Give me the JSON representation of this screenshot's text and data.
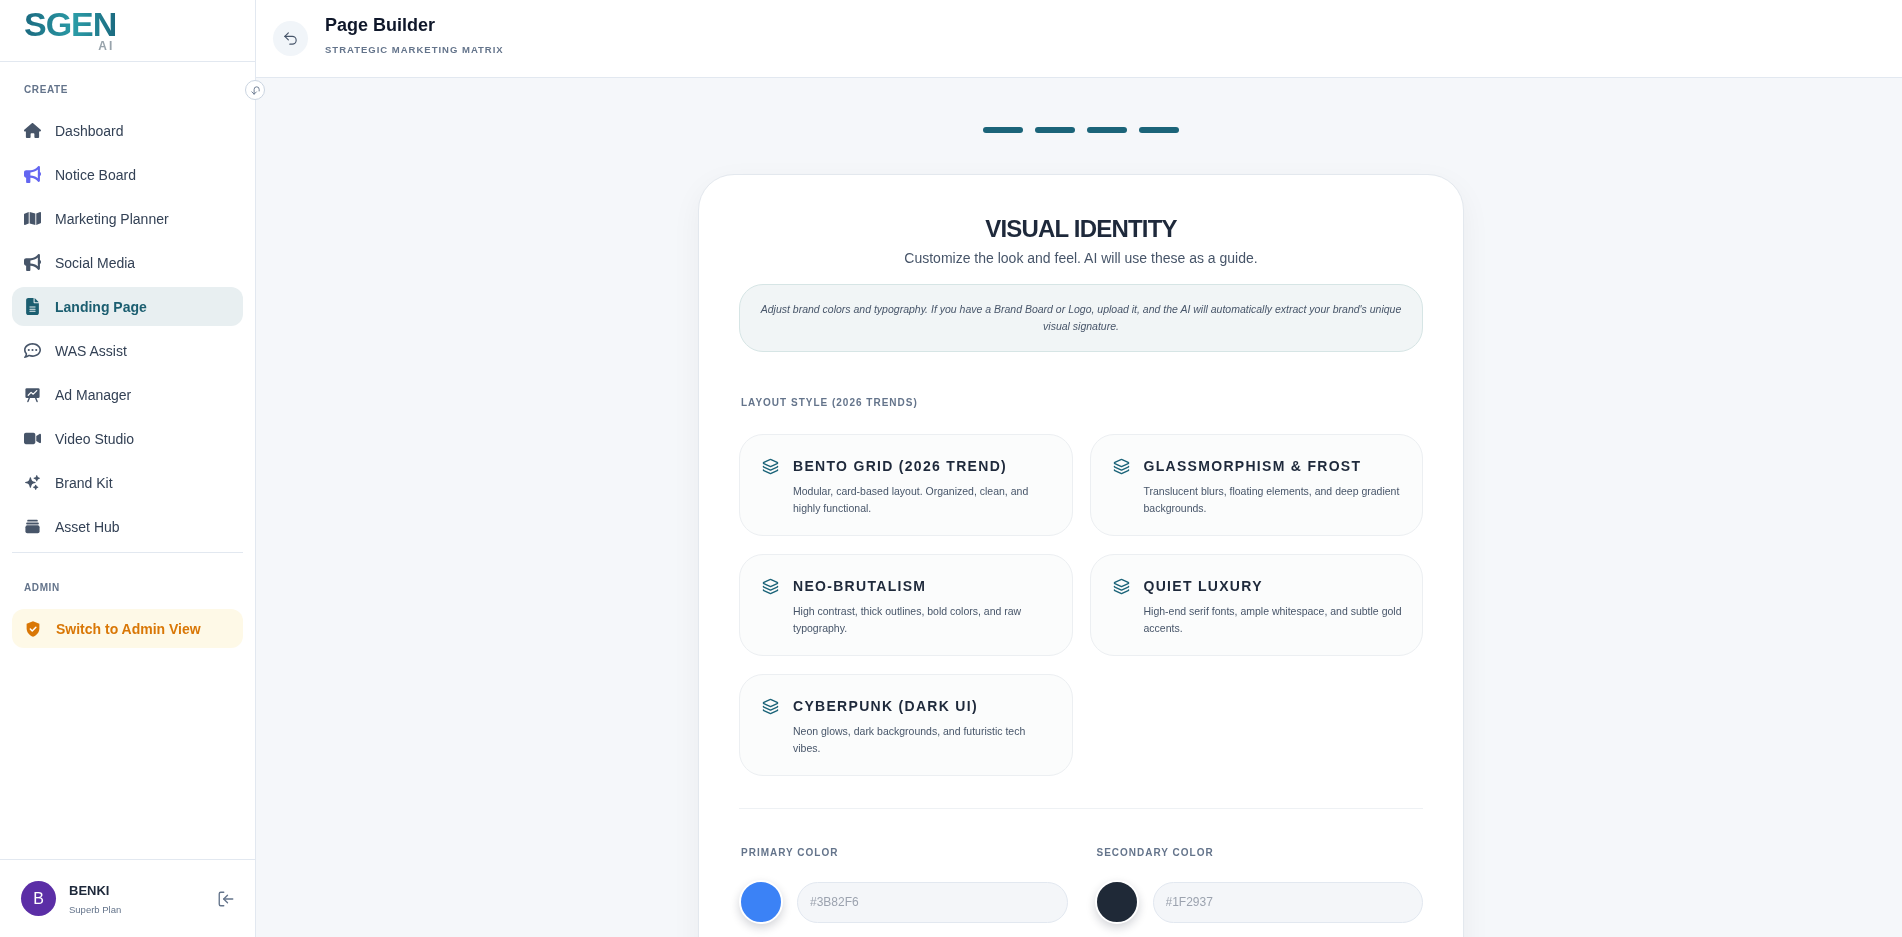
{
  "sidebar": {
    "logo": {
      "text": "SGEN",
      "suffix": "AI"
    },
    "section_title": "CREATE",
    "items": [
      {
        "label": "Dashboard",
        "selected": false
      },
      {
        "label": "Notice Board",
        "selected": false,
        "color": "#6366f1"
      },
      {
        "label": "Marketing Planner",
        "selected": false
      },
      {
        "label": "Social Media",
        "selected": false
      },
      {
        "label": "Landing Page",
        "selected": true
      },
      {
        "label": "WAS Assist",
        "selected": false
      },
      {
        "label": "Ad Manager",
        "selected": false
      },
      {
        "label": "Video Studio",
        "selected": false
      },
      {
        "label": "Brand Kit",
        "selected": false
      },
      {
        "label": "Asset Hub",
        "selected": false
      }
    ],
    "admin": {
      "title": "ADMIN",
      "action": "Switch to Admin View"
    },
    "user": {
      "avatar": "B",
      "name": "BENKI",
      "plan": "Superb Plan"
    }
  },
  "header": {
    "title": "Page Builder",
    "subtitle": "STRATEGIC MARKETING MATRIX"
  },
  "stepper": [
    {
      "done": true
    },
    {
      "done": true
    },
    {
      "done": true
    },
    {
      "done": true
    }
  ],
  "card": {
    "title": "VISUAL IDENTITY",
    "subtitle": "Customize the look and feel. AI will use these as a guide.",
    "note": "Adjust brand colors and typography. If you have a Brand Board or Logo, upload it, and the AI will automatically extract your brand's unique visual signature.",
    "layout_label": "LAYOUT STYLE (2026 TRENDS)",
    "layout_options": [
      {
        "title": "BENTO GRID (2026 TREND)",
        "description": "Modular, card-based layout. Organized, clean, and highly functional.",
        "selected": false
      },
      {
        "title": "GLASSMORPHISM & FROST",
        "description": "Translucent blurs, floating elements, and deep gradient backgrounds.",
        "selected": false
      },
      {
        "title": "NEO-BRUTALISM",
        "description": "High contrast, thick outlines, bold colors, and raw typography.",
        "selected": false
      },
      {
        "title": "QUIET LUXURY",
        "description": "High-end serif fonts, ample whitespace, and subtle gold accents.",
        "selected": false
      },
      {
        "title": "CYBERPUNK (DARK UI)",
        "description": "Neon glows, dark backgrounds, and futuristic tech vibes.",
        "selected": false
      }
    ],
    "colors": [
      {
        "label": "PRIMARY COLOR",
        "color": "#3b82f6",
        "value": "#3B82F6"
      },
      {
        "label": "SECONDARY COLOR",
        "color": "#1f2937",
        "value": "#1F2937"
      }
    ]
  }
}
